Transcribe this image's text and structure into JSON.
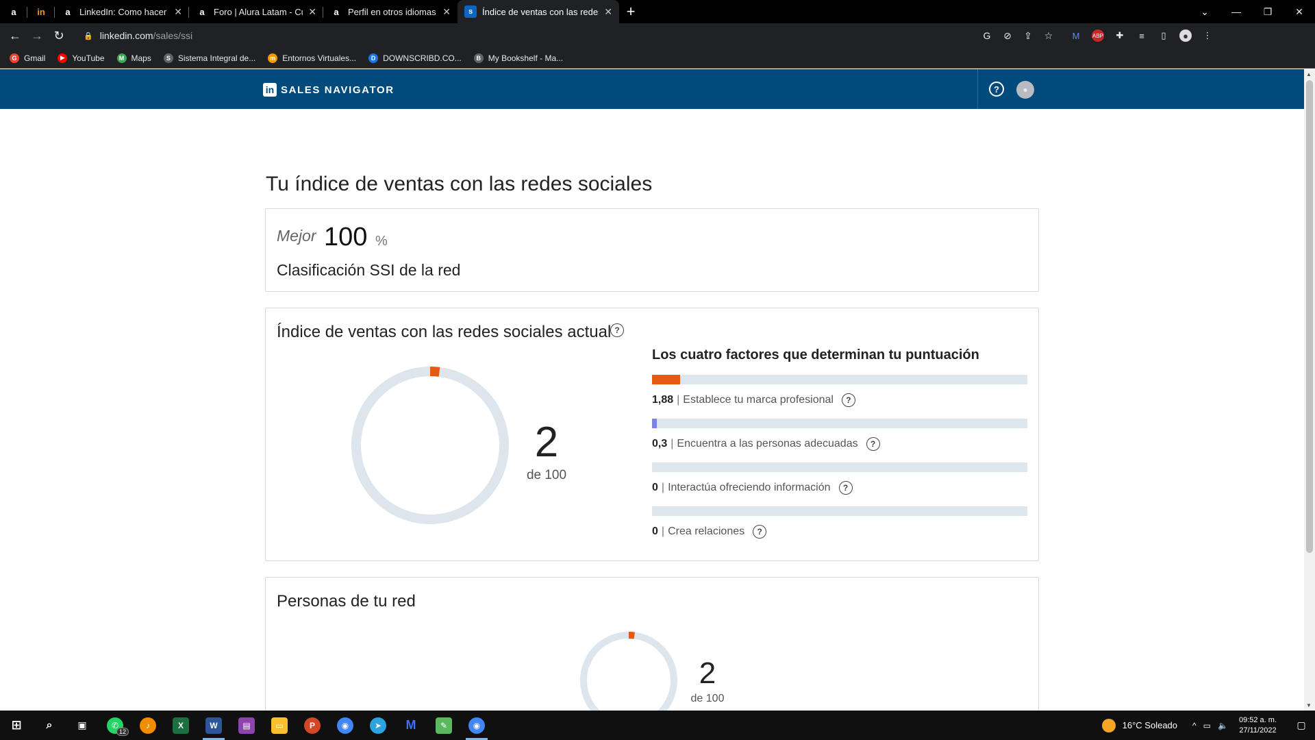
{
  "browser": {
    "tabs": [
      {
        "label": "",
        "favicon": "a",
        "pinned": true
      },
      {
        "label": "",
        "favicon": "in",
        "pinned": true
      },
      {
        "label": "LinkedIn: Como hacer que tu per",
        "favicon": "a"
      },
      {
        "label": "Foro | Alura Latam - Cursos onlin",
        "favicon": "a"
      },
      {
        "label": "Perfil en otros idiomas | LinkedIn",
        "favicon": "a"
      },
      {
        "label": "Índice de ventas con las redes so",
        "favicon": "s",
        "active": true
      }
    ],
    "url_host": "linkedin.com",
    "url_path": "/sales/ssi",
    "bookmarks": [
      {
        "label": "Gmail",
        "icon": "G",
        "color": "#ea4335"
      },
      {
        "label": "YouTube",
        "icon": "▶",
        "color": "#ff0000"
      },
      {
        "label": "Maps",
        "icon": "M",
        "color": "#34a853"
      },
      {
        "label": "Sistema Integral de...",
        "icon": "S",
        "color": "#5f6368"
      },
      {
        "label": "Entornos Virtuales...",
        "icon": "m",
        "color": "#f29900"
      },
      {
        "label": "DOWNSCRIBD.CO...",
        "icon": "D",
        "color": "#1a73e8"
      },
      {
        "label": "My Bookshelf - Ma...",
        "icon": "B",
        "color": "#5f6368"
      }
    ]
  },
  "app": {
    "brand": "SALES NAVIGATOR",
    "logo": "in"
  },
  "page": {
    "title": "Tu índice de ventas con las redes sociales"
  },
  "ranking": {
    "label": "Mejor",
    "value": "100",
    "unit": "%",
    "caption": "Clasificación SSI de la red"
  },
  "ssi": {
    "title": "Índice de ventas con las redes sociales actual",
    "score": 2,
    "score_text": "2",
    "max": 100,
    "of_text": "de 100",
    "factors_heading": "Los cuatro factores que determinan tu puntuación",
    "factors": [
      {
        "value": "1,88",
        "label": "Establece tu marca profesional",
        "fraction": 0.075,
        "color": "#e35a10"
      },
      {
        "value": "0,3",
        "label": "Encuentra a las personas adecuadas",
        "fraction": 0.012,
        "color": "#7b83eb"
      },
      {
        "value": "0",
        "label": "Interactúa ofreciendo información",
        "fraction": 0,
        "color": "#e35a10"
      },
      {
        "value": "0",
        "label": "Crea relaciones",
        "fraction": 0,
        "color": "#e35a10"
      }
    ]
  },
  "network": {
    "title": "Personas de tu red",
    "score": 2,
    "score_text": "2",
    "max": 100,
    "of_text": "de 100"
  },
  "colors": {
    "accent": "#e35a10",
    "track": "#dde6ed",
    "header": "#004b7c"
  },
  "taskbar": {
    "weather": "16°C  Soleado",
    "time": "09:52 a. m.",
    "date": "27/11/2022",
    "whatsapp_badge": "12"
  }
}
